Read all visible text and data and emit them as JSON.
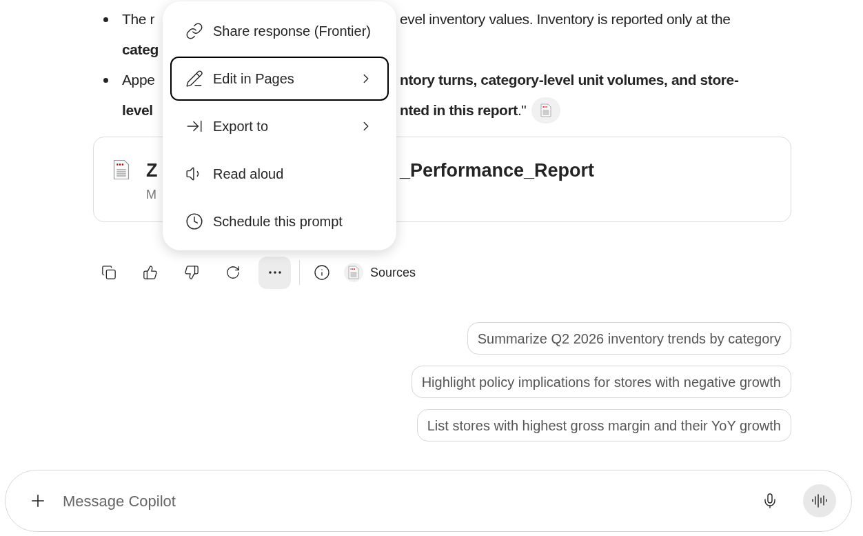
{
  "response": {
    "bullets": [
      {
        "lines": [
          {
            "left": [
              {
                "text": "The r",
                "bold": false
              }
            ],
            "right": [
              {
                "text": "evel inventory values. Inventory is reported only at the",
                "bold": false
              }
            ],
            "citation": false
          },
          {
            "left": [
              {
                "text": "categ",
                "bold": true
              }
            ],
            "citation": false
          }
        ]
      },
      {
        "lines": [
          {
            "left": [
              {
                "text": "Appe",
                "bold": false
              }
            ],
            "right": [
              {
                "text": "ntory turns, category-level unit volumes, and store-",
                "bold": true
              }
            ],
            "citation": false
          },
          {
            "left": [
              {
                "text": "level",
                "bold": true
              }
            ],
            "right": [
              {
                "text": "nted in this report",
                "bold": true
              },
              {
                "text": ".\"",
                "bold": false
              }
            ],
            "citation": true
          }
        ]
      }
    ]
  },
  "document": {
    "title_left": "Z",
    "title_right": "_Performance_Report",
    "subtitle": "M"
  },
  "menu": {
    "items": [
      {
        "label": "Share response (Frontier)",
        "submenu": false,
        "selected": false
      },
      {
        "label": "Edit in Pages",
        "submenu": true,
        "selected": true
      },
      {
        "label": "Export to",
        "submenu": true,
        "selected": false
      },
      {
        "label": "Read aloud",
        "submenu": false,
        "selected": false
      },
      {
        "label": "Schedule this prompt",
        "submenu": false,
        "selected": false
      }
    ]
  },
  "actions": {
    "more_active": true,
    "sources_label": "Sources"
  },
  "suggestions": [
    "Summarize Q2 2026 inventory trends by category",
    "Highlight policy implications for stores with negative growth",
    "List stores with highest gross margin and their YoY growth"
  ],
  "composer": {
    "placeholder": "Message Copilot"
  }
}
